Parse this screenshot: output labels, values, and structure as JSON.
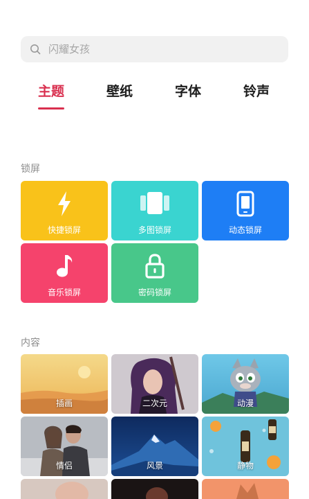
{
  "search": {
    "placeholder": "闪耀女孩"
  },
  "tabs": [
    {
      "label": "主题",
      "active": true
    },
    {
      "label": "壁纸",
      "active": false
    },
    {
      "label": "字体",
      "active": false
    },
    {
      "label": "铃声",
      "active": false
    }
  ],
  "lockscreen": {
    "title": "锁屏",
    "items": [
      {
        "label": "快捷锁屏",
        "icon": "lightning-icon",
        "color": "#f9c21a"
      },
      {
        "label": "多图锁屏",
        "icon": "multi-image-icon",
        "color": "#3ad4d0"
      },
      {
        "label": "动态锁屏",
        "icon": "phone-icon",
        "color": "#1e7ef5"
      },
      {
        "label": "音乐锁屏",
        "icon": "music-note-icon",
        "color": "#f5436c"
      },
      {
        "label": "密码锁屏",
        "icon": "lock-icon",
        "color": "#48c78a"
      }
    ]
  },
  "content": {
    "title": "内容",
    "items": [
      {
        "label": "插画"
      },
      {
        "label": "二次元"
      },
      {
        "label": "动漫"
      },
      {
        "label": "情侣"
      },
      {
        "label": "风景"
      },
      {
        "label": "静物"
      }
    ]
  },
  "colors": {
    "accent": "#d9304f"
  }
}
